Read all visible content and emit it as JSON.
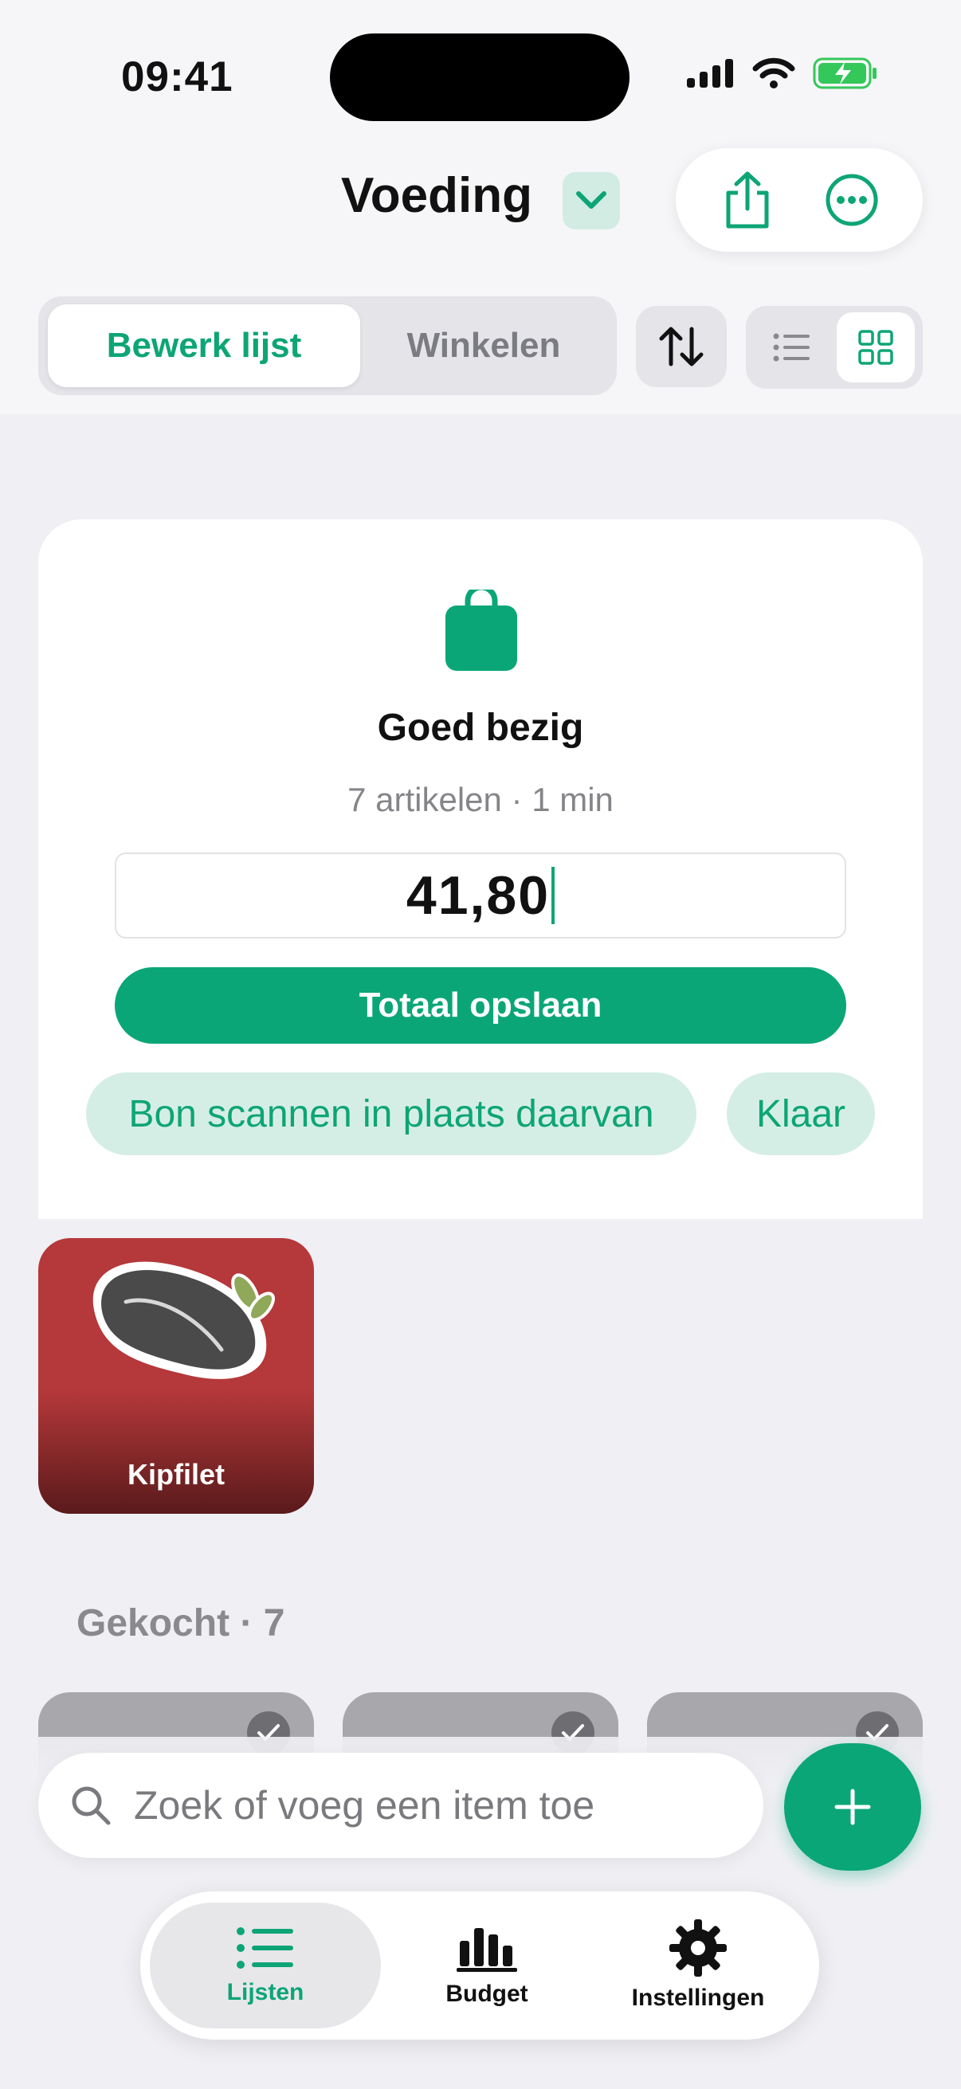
{
  "status_bar": {
    "time": "09:41"
  },
  "header": {
    "title": "Voeding",
    "segments": {
      "edit": "Bewerk lijst",
      "shop": "Winkelen"
    }
  },
  "summary_card": {
    "title": "Goed bezig",
    "subtitle": "7 artikelen · 1 min",
    "amount_value": "41,80",
    "save_label": "Totaal opslaan",
    "scan_label": "Bon scannen in plaats daarvan",
    "done_label": "Klaar"
  },
  "items": [
    {
      "label": "Kipfilet"
    }
  ],
  "bought_section": {
    "label": "Gekocht · 7"
  },
  "search": {
    "placeholder": "Zoek of voeg een item toe"
  },
  "tabbar": {
    "lists": "Lijsten",
    "budget": "Budget",
    "settings": "Instellingen"
  },
  "colors": {
    "accent": "#0ba677",
    "accent_soft": "#d5eee5",
    "tile_red": "#b5383a"
  },
  "icons": [
    "signal-icon",
    "wifi-icon",
    "battery-charging-icon",
    "chevron-down-icon",
    "share-icon",
    "more-icon",
    "sort-icon",
    "list-view-icon",
    "grid-view-icon",
    "shopping-bag-icon",
    "search-icon",
    "plus-icon",
    "list-icon",
    "chart-icon",
    "gear-icon"
  ]
}
